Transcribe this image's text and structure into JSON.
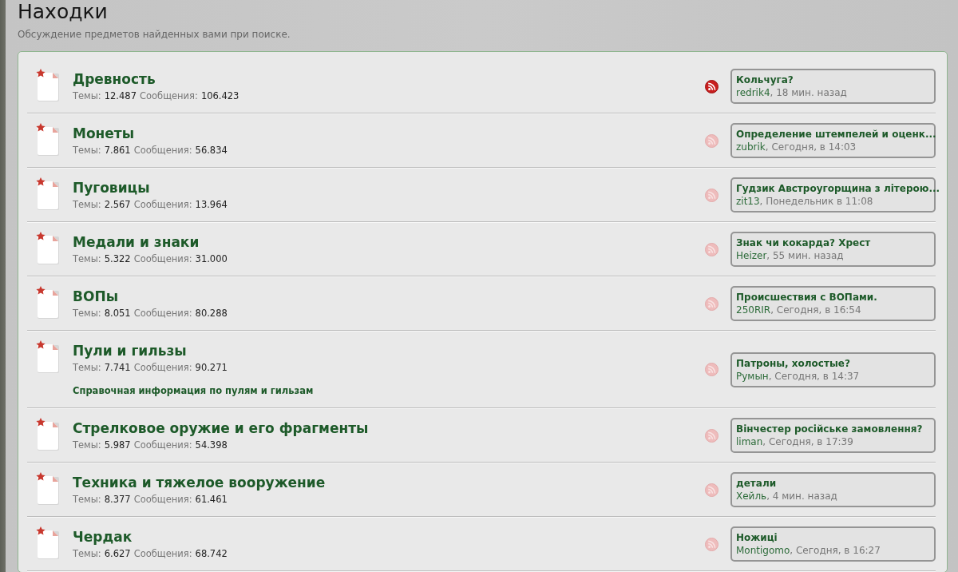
{
  "page": {
    "title": "Находки",
    "description": "Обсуждение предметов найденных вами при поиске."
  },
  "forums": [
    {
      "title": "Древность",
      "stats": [
        {
          "label": "Темы:",
          "value": "12.487"
        },
        {
          "label": "Сообщения:",
          "value": "106.423"
        }
      ],
      "rss_highlighted": true,
      "last_post": {
        "title": "Кольчуга?",
        "author": "redrik4",
        "time": ", 18 мин. назад"
      }
    },
    {
      "title": "Монеты",
      "stats": [
        {
          "label": "Темы:",
          "value": "7.861"
        },
        {
          "label": "Сообщения:",
          "value": "56.834"
        }
      ],
      "rss_highlighted": false,
      "last_post": {
        "title": "Определение штемпелей и оценк...",
        "author": "zubrik",
        "time": ", Сегодня, в 14:03"
      }
    },
    {
      "title": "Пуговицы",
      "stats": [
        {
          "label": "Темы:",
          "value": "2.567"
        },
        {
          "label": "Сообщения:",
          "value": "13.964"
        }
      ],
      "rss_highlighted": false,
      "last_post": {
        "title": "Гудзик Австроугорщина з літерою...",
        "author": "zit13",
        "time": ", Понедельник в 11:08"
      }
    },
    {
      "title": "Медали и знаки",
      "stats": [
        {
          "label": "Темы:",
          "value": "5.322"
        },
        {
          "label": "Сообщения:",
          "value": "31.000"
        }
      ],
      "rss_highlighted": false,
      "last_post": {
        "title": "Знак чи кокарда? Хрест",
        "author": "Heizer",
        "time": ", 55 мин. назад"
      }
    },
    {
      "title": "ВОПы",
      "stats": [
        {
          "label": "Темы:",
          "value": "8.051"
        },
        {
          "label": "Сообщения:",
          "value": "80.288"
        }
      ],
      "rss_highlighted": false,
      "last_post": {
        "title": "Происшествия с ВОПами.",
        "author": "250RIR",
        "time": ", Сегодня, в 16:54"
      }
    },
    {
      "title": "Пули и гильзы",
      "stats": [
        {
          "label": "Темы:",
          "value": "7.741"
        },
        {
          "label": "Сообщения:",
          "value": "90.271"
        }
      ],
      "subforums": [
        "Справочная информация по пулям и гильзам"
      ],
      "rss_highlighted": false,
      "last_post": {
        "title": "Патроны, холостые?",
        "author": "Румын",
        "time": ", Сегодня, в 14:37"
      }
    },
    {
      "title": "Стрелковое оружие и его фрагменты",
      "stats": [
        {
          "label": "Темы:",
          "value": "5.987"
        },
        {
          "label": "Сообщения:",
          "value": "54.398"
        }
      ],
      "rss_highlighted": false,
      "last_post": {
        "title": "Вінчестер російське замовлення?",
        "author": "liman",
        "time": ", Сегодня, в 17:39"
      }
    },
    {
      "title": "Техника и тяжелое вооружение",
      "stats": [
        {
          "label": "Темы:",
          "value": "8.377"
        },
        {
          "label": "Сообщения:",
          "value": "61.461"
        }
      ],
      "rss_highlighted": false,
      "last_post": {
        "title": "детали",
        "author": "Хейль",
        "time": ", 4 мин. назад"
      }
    },
    {
      "title": "Чердак",
      "stats": [
        {
          "label": "Темы:",
          "value": "6.627"
        },
        {
          "label": "Сообщения:",
          "value": "68.742"
        }
      ],
      "rss_highlighted": false,
      "last_post": {
        "title": "Ножиці",
        "author": "Montigomo",
        "time": ", Сегодня, в 16:27"
      }
    }
  ]
}
